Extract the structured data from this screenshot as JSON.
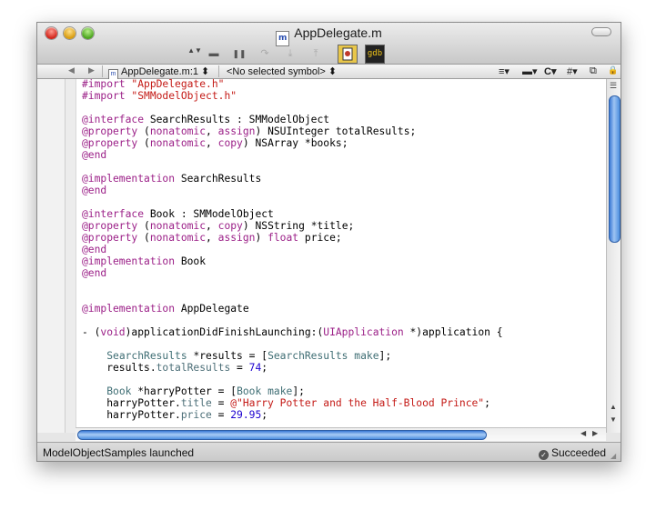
{
  "window": {
    "title": "AppDelegate.m",
    "file_icon": "m"
  },
  "toolbar": {
    "stepper": "▲▼",
    "buttons": [
      {
        "icon": "breakpoints-icon",
        "glyph": "▬"
      },
      {
        "icon": "pause-icon",
        "glyph": "❚❚"
      },
      {
        "icon": "step-over-icon",
        "glyph": "↷"
      },
      {
        "icon": "step-into-icon",
        "glyph": "⤓"
      },
      {
        "icon": "step-out-icon",
        "glyph": "⤒"
      }
    ],
    "debugger_label": "gdb"
  },
  "navbar": {
    "back": "◀",
    "forward": "▶",
    "file": "AppDelegate.m:1 ⬍",
    "symbol": "<No selected symbol> ⬍",
    "bookmarks": "≡▾",
    "breakpoints": "▬▾",
    "class_menu": "C▾",
    "pragma_menu": "#▾",
    "split": "⧉",
    "lock": "🔒"
  },
  "code_lines": [
    [
      {
        "t": "#import ",
        "c": "kw"
      },
      {
        "t": "\"AppDelegate.h\"",
        "c": "str"
      }
    ],
    [
      {
        "t": "#import ",
        "c": "kw"
      },
      {
        "t": "\"SMModelObject.h\"",
        "c": "str"
      }
    ],
    [],
    [
      {
        "t": "@interface",
        "c": "kw"
      },
      {
        "t": " SearchResults : SMModelObject",
        "c": ""
      }
    ],
    [
      {
        "t": "@property",
        "c": "kw"
      },
      {
        "t": " (",
        "c": ""
      },
      {
        "t": "nonatomic",
        "c": "kw"
      },
      {
        "t": ", ",
        "c": ""
      },
      {
        "t": "assign",
        "c": "kw"
      },
      {
        "t": ") NSUInteger totalResults;",
        "c": ""
      }
    ],
    [
      {
        "t": "@property",
        "c": "kw"
      },
      {
        "t": " (",
        "c": ""
      },
      {
        "t": "nonatomic",
        "c": "kw"
      },
      {
        "t": ", ",
        "c": ""
      },
      {
        "t": "copy",
        "c": "kw"
      },
      {
        "t": ") NSArray *books;",
        "c": ""
      }
    ],
    [
      {
        "t": "@end",
        "c": "kw"
      }
    ],
    [],
    [
      {
        "t": "@implementation",
        "c": "kw"
      },
      {
        "t": " SearchResults",
        "c": ""
      }
    ],
    [
      {
        "t": "@end",
        "c": "kw"
      }
    ],
    [],
    [
      {
        "t": "@interface",
        "c": "kw"
      },
      {
        "t": " Book : SMModelObject",
        "c": ""
      }
    ],
    [
      {
        "t": "@property",
        "c": "kw"
      },
      {
        "t": " (",
        "c": ""
      },
      {
        "t": "nonatomic",
        "c": "kw"
      },
      {
        "t": ", ",
        "c": ""
      },
      {
        "t": "copy",
        "c": "kw"
      },
      {
        "t": ") NSString *title;",
        "c": ""
      }
    ],
    [
      {
        "t": "@property",
        "c": "kw"
      },
      {
        "t": " (",
        "c": ""
      },
      {
        "t": "nonatomic",
        "c": "kw"
      },
      {
        "t": ", ",
        "c": ""
      },
      {
        "t": "assign",
        "c": "kw"
      },
      {
        "t": ") ",
        "c": ""
      },
      {
        "t": "float",
        "c": "kw"
      },
      {
        "t": " price;",
        "c": ""
      }
    ],
    [
      {
        "t": "@end",
        "c": "kw"
      }
    ],
    [
      {
        "t": "@implementation",
        "c": "kw"
      },
      {
        "t": " Book",
        "c": ""
      }
    ],
    [
      {
        "t": "@end",
        "c": "kw"
      }
    ],
    [],
    [],
    [
      {
        "t": "@implementation",
        "c": "kw"
      },
      {
        "t": " AppDelegate",
        "c": ""
      }
    ],
    [],
    [
      {
        "t": "- (",
        "c": ""
      },
      {
        "t": "void",
        "c": "kw"
      },
      {
        "t": ")applicationDidFinishLaunching:(",
        "c": ""
      },
      {
        "t": "UIApplication",
        "c": "kw"
      },
      {
        "t": " *)application {",
        "c": ""
      }
    ],
    [],
    [
      {
        "t": "    ",
        "c": ""
      },
      {
        "t": "SearchResults",
        "c": "cls"
      },
      {
        "t": " *results = [",
        "c": ""
      },
      {
        "t": "SearchResults",
        "c": "cls"
      },
      {
        "t": " ",
        "c": ""
      },
      {
        "t": "make",
        "c": "cls"
      },
      {
        "t": "];",
        "c": ""
      }
    ],
    [
      {
        "t": "    results.",
        "c": ""
      },
      {
        "t": "totalResults",
        "c": "prop"
      },
      {
        "t": " = ",
        "c": ""
      },
      {
        "t": "74",
        "c": "num"
      },
      {
        "t": ";",
        "c": ""
      }
    ],
    [],
    [
      {
        "t": "    ",
        "c": ""
      },
      {
        "t": "Book",
        "c": "cls"
      },
      {
        "t": " *harryPotter = [",
        "c": ""
      },
      {
        "t": "Book",
        "c": "cls"
      },
      {
        "t": " ",
        "c": ""
      },
      {
        "t": "make",
        "c": "cls"
      },
      {
        "t": "];",
        "c": ""
      }
    ],
    [
      {
        "t": "    harryPotter.",
        "c": ""
      },
      {
        "t": "title",
        "c": "prop"
      },
      {
        "t": " = ",
        "c": ""
      },
      {
        "t": "@\"Harry Potter and the Half-Blood Prince\"",
        "c": "str"
      },
      {
        "t": ";",
        "c": ""
      }
    ],
    [
      {
        "t": "    harryPotter.",
        "c": ""
      },
      {
        "t": "price",
        "c": "prop"
      },
      {
        "t": " = ",
        "c": ""
      },
      {
        "t": "29.95",
        "c": "num"
      },
      {
        "t": ";",
        "c": ""
      }
    ]
  ],
  "status": {
    "left": "ModelObjectSamples launched",
    "right": "Succeeded",
    "right_icon": "success-icon"
  },
  "colors": {
    "keyword": "#9b1f87",
    "string": "#c41a16",
    "class": "#3f6e74",
    "number": "#1c00cf",
    "scroll_thumb": "#4d8fe0"
  }
}
